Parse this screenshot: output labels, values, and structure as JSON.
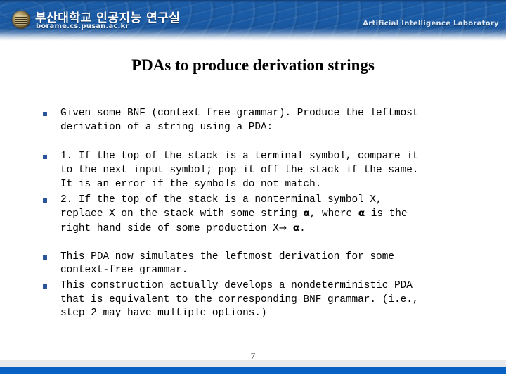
{
  "header": {
    "lab_name_ko": "부산대학교 인공지능 연구실",
    "lab_url": "borame.cs.pusan.ac.kr",
    "lab_name_en": "Artificial Intelligence Laboratory",
    "banner_color": "#1a5aa4",
    "logo_icon": "university-seal-icon"
  },
  "slide": {
    "title": "PDAs to produce derivation strings",
    "page_number": "7",
    "bullets": [
      {
        "marker": "square-bullet",
        "lines": [
          "Given some BNF (context free grammar). Produce the leftmost",
          "derivation of a string using a PDA:"
        ]
      },
      {
        "marker": "square-bullet",
        "lines": [
          "1. If the top of the stack is a terminal symbol, compare it",
          "to the next input symbol; pop it off the stack if the same.",
          "It is an error if the symbols do not match."
        ]
      },
      {
        "marker": "square-bullet",
        "lines_rich": [
          "2. If the top of the stack is a nonterminal symbol X,",
          "replace X on the stack with some string α, where α is the",
          "right hand side of some production X→ α."
        ],
        "line1": "2. If the top of the stack is a nonterminal symbol X,",
        "line2_a": "replace X on the stack with some string ",
        "line2_alpha1": "α",
        "line2_b": ", where ",
        "line2_alpha2": "α",
        "line2_c": " is the",
        "line3_a": "right hand side of some production X",
        "line3_arrow": "→",
        "line3_b": " ",
        "line3_alpha": "α",
        "line3_c": "."
      },
      {
        "marker": "square-bullet",
        "lines": [
          "This PDA now simulates the leftmost derivation for some",
          "context-free grammar."
        ]
      },
      {
        "marker": "square-bullet",
        "lines": [
          "This construction actually develops a nondeterministic PDA",
          "that is equivalent to the corresponding BNF grammar. (i.e.,",
          "step 2 may have multiple options.)"
        ]
      }
    ]
  },
  "footer": {
    "gray_band_color": "#e8eaec",
    "blue_bar_color": "#0862c4"
  }
}
